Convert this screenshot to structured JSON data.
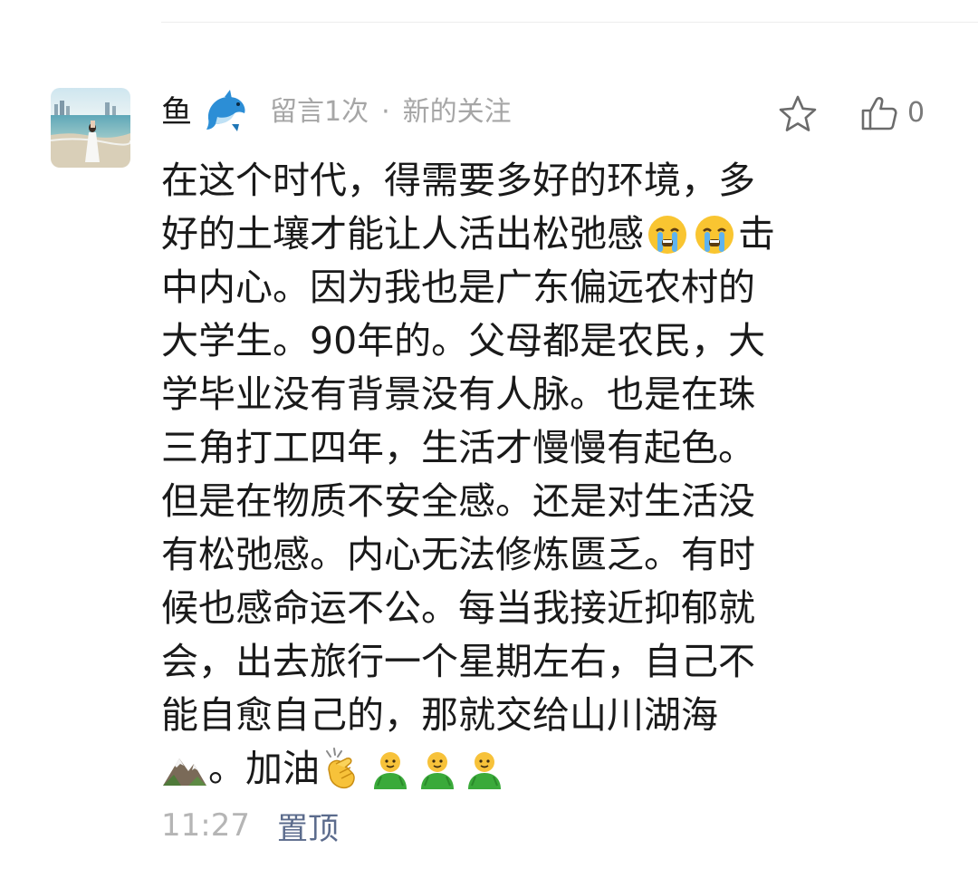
{
  "comment": {
    "author_name": "鱼",
    "author_emoji": "dolphin-icon",
    "meta_count": "留言1次",
    "meta_separator": "·",
    "meta_status": "新的关注",
    "like_count": "0",
    "lines": [
      "在这个时代，得需要多好的环境，多",
      "好的土壤才能让人活出松弛感",
      "击",
      "中内心。因为我也是广东偏远农村的",
      "大学生。90年的。父母都是农民，大",
      "学毕业没有背景没有人脉。也是在珠",
      "三角打工四年，生活才慢慢有起色。",
      "但是在物质不安全感。还是对生活没",
      "有松弛感。内心无法修炼匮乏。有时",
      "候也感命运不公。每当我接近抑郁就",
      "会，出去旅行一个星期左右，自己不",
      "能自愈自己的，那就交给山川湖海",
      "。加油"
    ],
    "time": "11:27",
    "pin_label": "置顶"
  },
  "colors": {
    "text_primary": "#1a1a1a",
    "text_meta": "#a6a6a6",
    "pin_link": "#5b6b8c",
    "divider": "#ededed"
  }
}
